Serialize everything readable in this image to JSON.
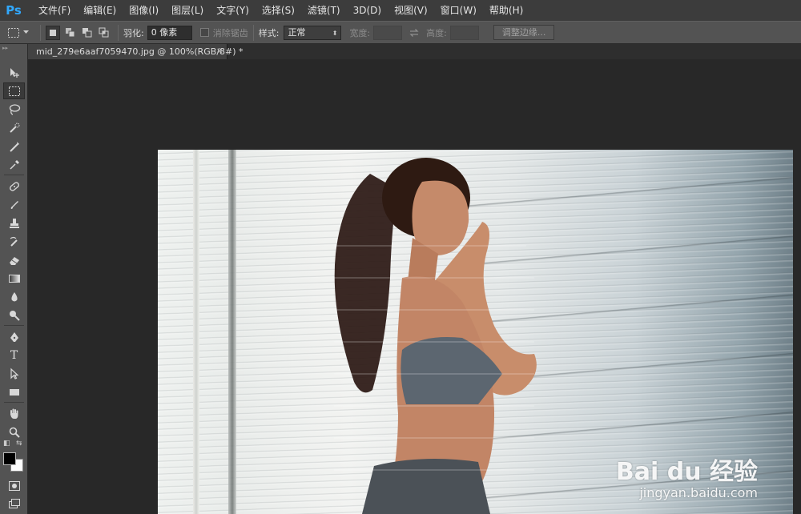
{
  "app": {
    "logo": "Ps"
  },
  "menu": [
    "文件(F)",
    "编辑(E)",
    "图像(I)",
    "图层(L)",
    "文字(Y)",
    "选择(S)",
    "滤镜(T)",
    "3D(D)",
    "视图(V)",
    "窗口(W)",
    "帮助(H)"
  ],
  "options": {
    "feather_label": "羽化:",
    "feather_value": "0 像素",
    "antialias_label": "消除锯齿",
    "style_label": "样式:",
    "style_value": "正常",
    "width_label": "宽度:",
    "height_label": "高度:",
    "refine_edge_button": "调整边缘..."
  },
  "document": {
    "tab_title": "mid_279e6aaf7059470.jpg @ 100%(RGB/8#) *",
    "close_glyph": "×"
  },
  "watermark": {
    "logo": "Bai du 经验",
    "url": "jingyan.baidu.com"
  },
  "colors": {
    "foreground": "#000000",
    "background": "#ffffff",
    "accent": "#31a8ff"
  },
  "tools": [
    "move-tool",
    "rect-marquee-tool",
    "lasso-tool",
    "quick-select-tool",
    "crop-tool",
    "eyedropper-tool",
    "healing-brush-tool",
    "brush-tool",
    "clone-stamp-tool",
    "history-brush-tool",
    "eraser-tool",
    "gradient-tool",
    "blur-tool",
    "dodge-tool",
    "pen-tool",
    "type-tool",
    "path-select-tool",
    "rectangle-tool",
    "hand-tool",
    "zoom-tool"
  ],
  "type_tool_glyph": "T"
}
